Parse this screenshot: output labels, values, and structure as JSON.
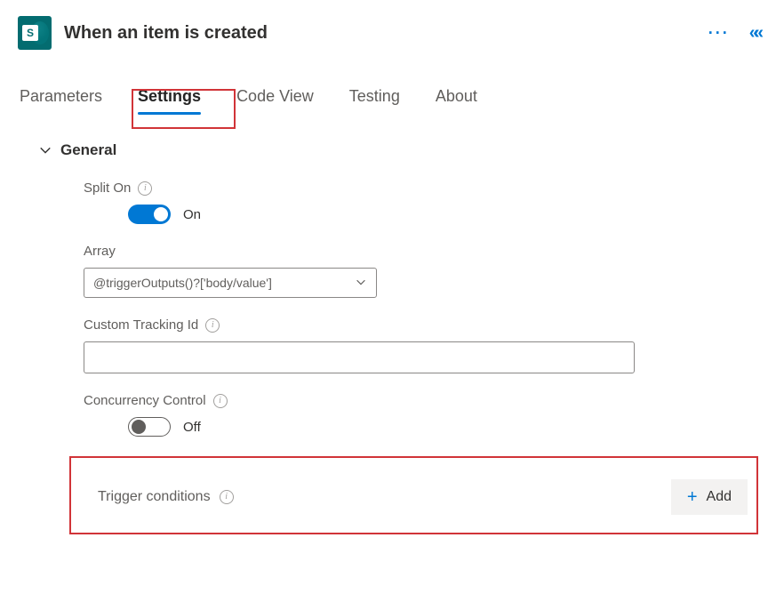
{
  "header": {
    "card_title": "When an item is created",
    "app_icon_letter": "S"
  },
  "tabs": {
    "parameters": "Parameters",
    "settings": "Settings",
    "code_view": "Code View",
    "testing": "Testing",
    "about": "About",
    "active": "settings"
  },
  "section": {
    "general_title": "General",
    "split_on": {
      "label": "Split On",
      "state_label": "On",
      "on": true
    },
    "array": {
      "label": "Array",
      "value": "@triggerOutputs()?['body/value']"
    },
    "custom_tracking": {
      "label": "Custom Tracking Id",
      "value": ""
    },
    "concurrency": {
      "label": "Concurrency Control",
      "state_label": "Off",
      "on": false
    },
    "trigger_conditions": {
      "label": "Trigger conditions",
      "add_label": "Add"
    }
  }
}
